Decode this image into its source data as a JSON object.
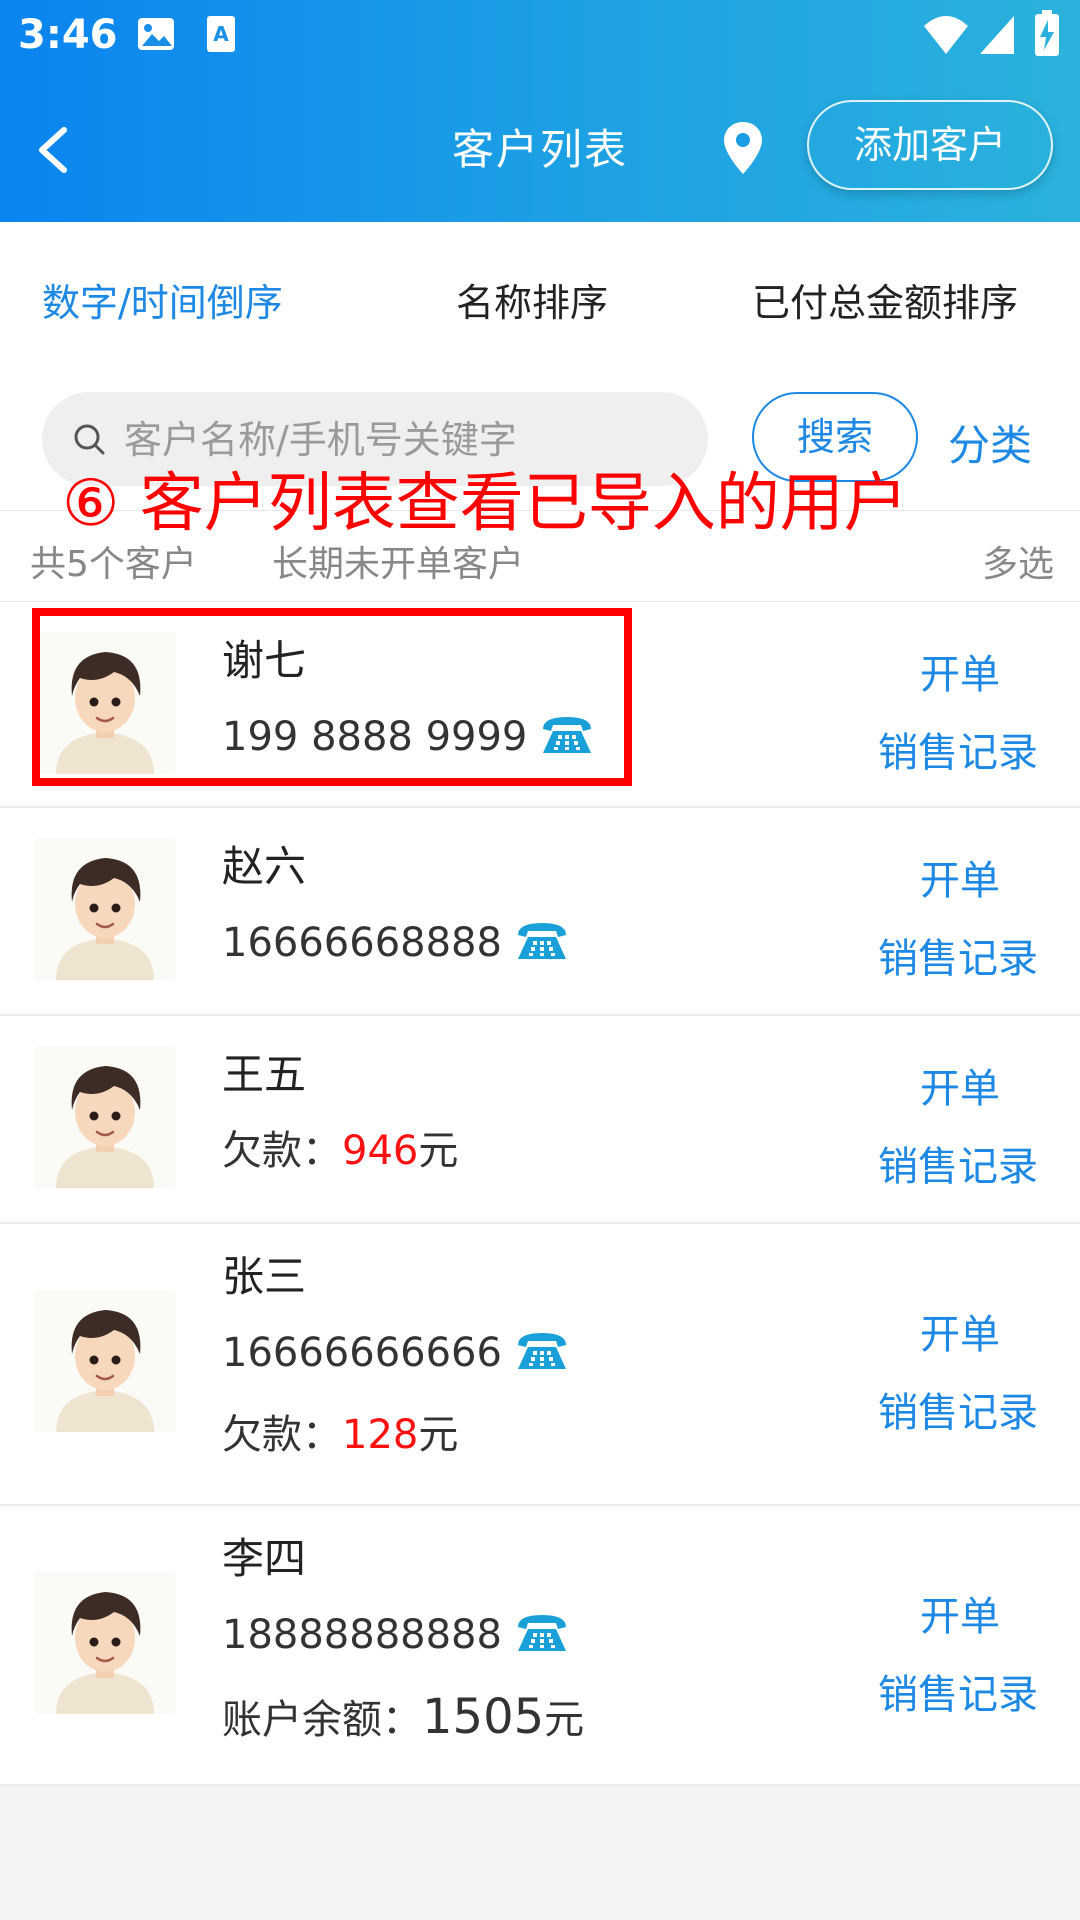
{
  "status_bar": {
    "time": "3:46"
  },
  "header": {
    "title": "客户列表",
    "add_customer_label": "添加客户"
  },
  "sort_tabs": [
    {
      "label": "数字/时间倒序",
      "active": true
    },
    {
      "label": "名称排序",
      "active": false
    },
    {
      "label": "已付总金额排序",
      "active": false
    }
  ],
  "search": {
    "placeholder": "客户名称/手机号关键字",
    "button_label": "搜索",
    "category_label": "分类"
  },
  "annotation": {
    "text": "⑥ 客户列表查看已导入的用户"
  },
  "summary": {
    "count_text": "共5个客户",
    "longterm_text": "长期未开单客户",
    "multi_select_label": "多选"
  },
  "actions": {
    "open_order": "开单",
    "sales_record": "销售记录"
  },
  "customers": [
    {
      "name": "谢七",
      "phone": "199 8888 9999"
    },
    {
      "name": "赵六",
      "phone": "16666668888"
    },
    {
      "name": "王五",
      "debt_label": "欠款：",
      "debt_value": "946",
      "debt_unit": "元"
    },
    {
      "name": "张三",
      "phone": "16666666666",
      "debt_label": "欠款：",
      "debt_value": "128",
      "debt_unit": "元"
    },
    {
      "name": "李四",
      "phone": "18888888888",
      "balance_label": "账户余额：",
      "balance_value": "1505",
      "balance_unit": "元"
    }
  ],
  "colors": {
    "accent": "#1e88e5",
    "debt": "#ff1010",
    "annotation": "#ff0000"
  }
}
